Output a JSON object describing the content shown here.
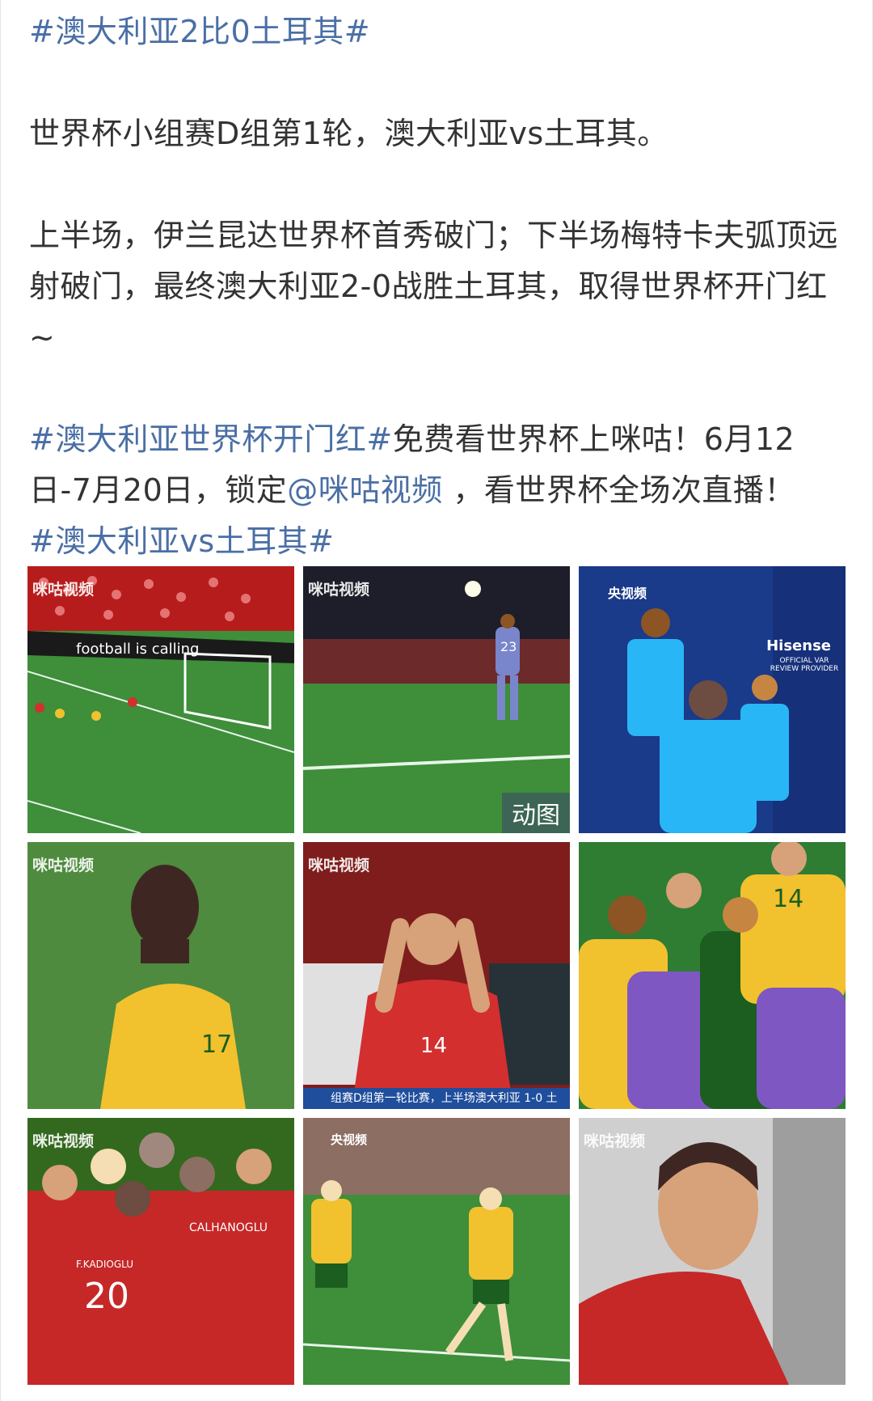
{
  "post": {
    "title_tag": "#澳大利亚2比0土耳其#",
    "line_intro": "世界杯小组赛D组第1轮，澳大利亚vs土耳其。",
    "summary": "上半场，伊兰昆达世界杯首秀破门；下半场梅特卡夫弧顶远射破门，最终澳大利亚2-0战胜土耳其，取得世界杯开门红~",
    "promo_tag": "#澳大利亚世界杯开门红#",
    "promo_text_1": "免费看世界杯上咪咕！6月12日-7月20日，锁定",
    "promo_mention": "@咪咕视频",
    "promo_text_2": " ，看世界杯全场次直播！",
    "end_tag": "#澳大利亚vs土耳其#"
  },
  "images": {
    "gif_badge": "动图",
    "caption_banner": "组赛D组第一轮比赛，上半场澳大利亚 1-0 土",
    "ad_board": "football is calling",
    "brand_hisense": "Hisense",
    "brand_var": "OFFICIAL VAR REVIEW PROVIDER",
    "jersey_numbers": [
      "23",
      "17",
      "14",
      "20"
    ],
    "player_names": [
      "CALHANOGLU",
      "F.KADIOGLU"
    ],
    "watermark": "咪咕视频",
    "cctv_mark": "央视频"
  },
  "colors": {
    "link": "#4a6fa5",
    "text": "#333333",
    "turkey_red": "#d32f2f",
    "australia_gold": "#f2c12e",
    "pitch_green": "#3e8e3a"
  }
}
